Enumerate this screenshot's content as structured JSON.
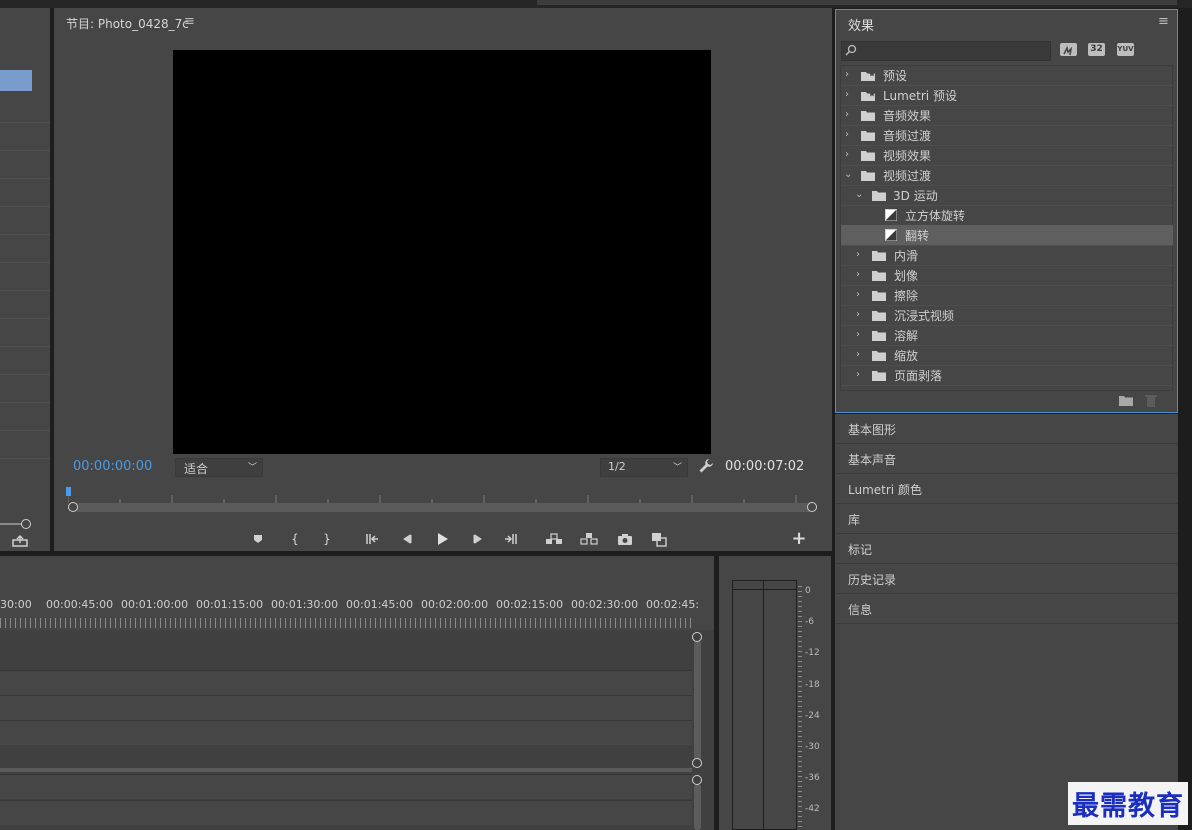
{
  "program_monitor": {
    "title": "节目: Photo_0428_7c",
    "timecode_current": "00:00:00:00",
    "fit_select": "适合",
    "resolution_select": "1/2",
    "timecode_duration": "00:00:07:02"
  },
  "effects_panel": {
    "title": "效果",
    "badges": [
      "32",
      "YUV"
    ],
    "tree": [
      {
        "label": "预设",
        "level": 0,
        "kind": "star-folder",
        "expanded": false
      },
      {
        "label": "Lumetri 预设",
        "level": 0,
        "kind": "star-folder",
        "expanded": false
      },
      {
        "label": "音频效果",
        "level": 0,
        "kind": "folder",
        "expanded": false
      },
      {
        "label": "音频过渡",
        "level": 0,
        "kind": "folder",
        "expanded": false
      },
      {
        "label": "视频效果",
        "level": 0,
        "kind": "folder",
        "expanded": false
      },
      {
        "label": "视频过渡",
        "level": 0,
        "kind": "folder",
        "expanded": true
      },
      {
        "label": "3D 运动",
        "level": 1,
        "kind": "folder",
        "expanded": true
      },
      {
        "label": "立方体旋转",
        "level": 2,
        "kind": "effect"
      },
      {
        "label": "翻转",
        "level": 2,
        "kind": "effect",
        "selected": true
      },
      {
        "label": "内滑",
        "level": 1,
        "kind": "folder",
        "expanded": false
      },
      {
        "label": "划像",
        "level": 1,
        "kind": "folder",
        "expanded": false
      },
      {
        "label": "擦除",
        "level": 1,
        "kind": "folder",
        "expanded": false
      },
      {
        "label": "沉浸式视频",
        "level": 1,
        "kind": "folder",
        "expanded": false
      },
      {
        "label": "溶解",
        "level": 1,
        "kind": "folder",
        "expanded": false
      },
      {
        "label": "缩放",
        "level": 1,
        "kind": "folder",
        "expanded": false
      },
      {
        "label": "页面剥落",
        "level": 1,
        "kind": "folder",
        "expanded": false
      }
    ]
  },
  "side_panels": [
    "基本图形",
    "基本声音",
    "Lumetri 颜色",
    "库",
    "标记",
    "历史记录",
    "信息"
  ],
  "timeline": {
    "ruler_labels": [
      "30:00",
      "00:00:45:00",
      "00:01:00:00",
      "00:01:15:00",
      "00:01:30:00",
      "00:01:45:00",
      "00:02:00:00",
      "00:02:15:00",
      "00:02:30:00",
      "00:02:45:"
    ]
  },
  "audio_meter": {
    "scale": [
      "0",
      "-6",
      "-12",
      "-18",
      "-24",
      "-30",
      "-36",
      "-42"
    ]
  },
  "watermark": "最需教育"
}
